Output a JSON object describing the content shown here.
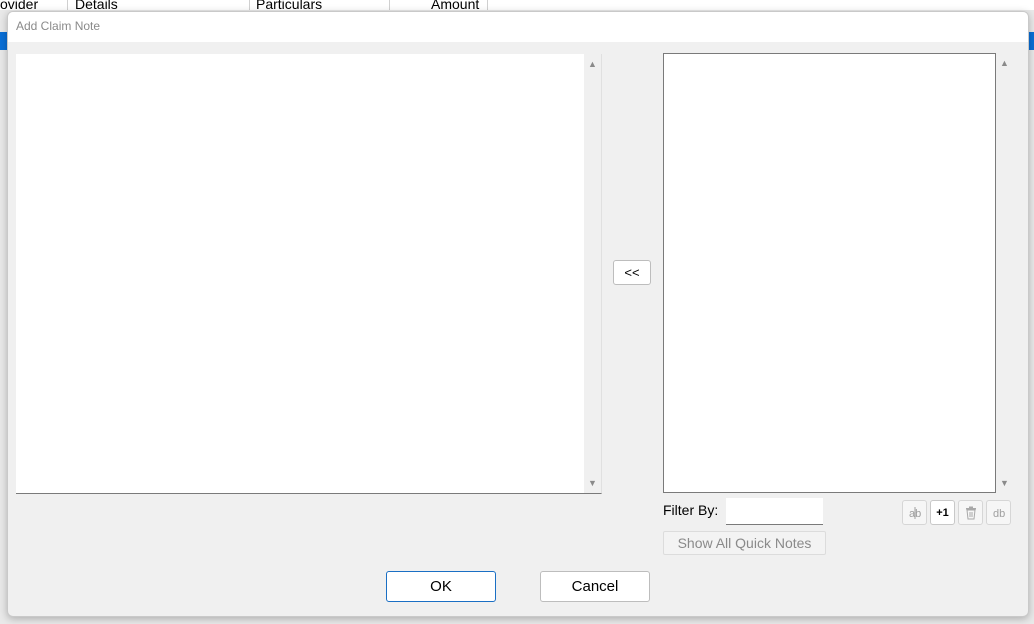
{
  "background": {
    "columns": [
      "ovider",
      "Details",
      "Particulars",
      "Amount"
    ],
    "accent_color": "#0a6fd6"
  },
  "dialog": {
    "title": "Add Claim Note",
    "note_text": "",
    "transfer_label": "<<",
    "filter_label": "Filter By:",
    "filter_value": "",
    "toolbar": {
      "edit_icon": "edit-icon",
      "add_label": "+1",
      "delete_icon": "trash-icon",
      "db_icon": "database-icon"
    },
    "show_all_label": "Show All Quick Notes",
    "ok_label": "OK",
    "cancel_label": "Cancel"
  }
}
